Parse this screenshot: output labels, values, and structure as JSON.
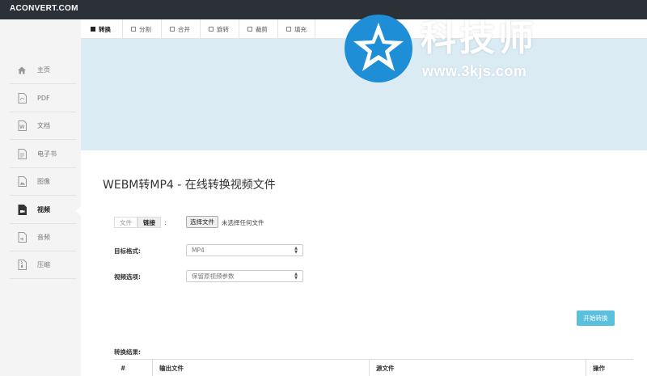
{
  "brand": "ACONVERT.COM",
  "sidebar": {
    "items": [
      {
        "label": "主页",
        "icon": "home-icon"
      },
      {
        "label": "PDF",
        "icon": "pdf-icon"
      },
      {
        "label": "文档",
        "icon": "document-icon"
      },
      {
        "label": "电子书",
        "icon": "ebook-icon"
      },
      {
        "label": "图像",
        "icon": "image-icon"
      },
      {
        "label": "视频",
        "icon": "video-icon",
        "active": true
      },
      {
        "label": "音频",
        "icon": "audio-icon"
      },
      {
        "label": "压缩",
        "icon": "archive-icon"
      }
    ]
  },
  "tabs": [
    {
      "label": "转换",
      "active": true
    },
    {
      "label": "分割"
    },
    {
      "label": "合并"
    },
    {
      "label": "旋转"
    },
    {
      "label": "裁剪"
    },
    {
      "label": "填充"
    }
  ],
  "watermark": {
    "title": "科技师",
    "url": "www.3kjs.com"
  },
  "main": {
    "title": "WEBM转MP4 - 在线转换视频文件",
    "source_toggle": {
      "file": "文件",
      "link": "链接",
      "colon": ":"
    },
    "choose_file": "选择文件",
    "no_file": "未选择任何文件",
    "target_format_label": "目标格式:",
    "target_format_value": "MP4",
    "video_options_label": "视频选项:",
    "video_options_value": "保留原视频参数",
    "start_button": "开始转换",
    "result_label": "转换结果:",
    "table_headers": [
      "#",
      "输出文件",
      "源文件",
      "操作"
    ]
  },
  "colors": {
    "topbar": "#2c3138",
    "banner": "#daebf4",
    "accent": "#5bc0de",
    "watermark_blue": "#1e8fd6"
  }
}
